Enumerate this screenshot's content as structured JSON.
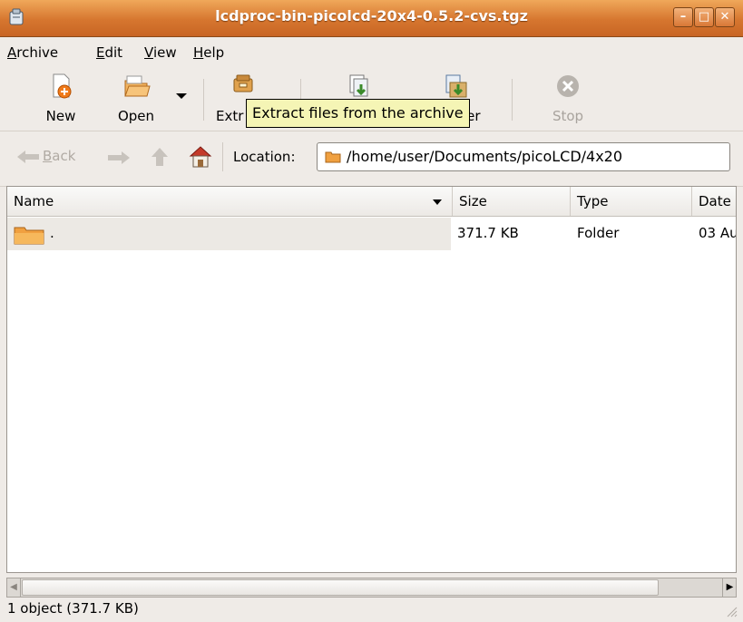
{
  "window": {
    "title": "lcdproc-bin-picolcd-20x4-0.5.2-cvs.tgz"
  },
  "menubar": {
    "items": [
      {
        "label_pre": "",
        "accel": "A",
        "label_post": "rchive"
      },
      {
        "label_pre": "",
        "accel": "E",
        "label_post": "dit"
      },
      {
        "label_pre": "",
        "accel": "V",
        "label_post": "iew"
      },
      {
        "label_pre": "",
        "accel": "H",
        "label_post": "elp"
      }
    ]
  },
  "toolbar": {
    "new_label": "New",
    "open_label": "Open",
    "extract_label": "Extr",
    "add_folder_label": "ler",
    "stop_label": "Stop"
  },
  "tooltip": {
    "text": "Extract files from the archive"
  },
  "location": {
    "back_label": "Back",
    "back_accel": "B",
    "back_rest": "ack",
    "location_label": "Location:",
    "path": "/home/user/Documents/picoLCD/4x20"
  },
  "list": {
    "columns": {
      "name": "Name",
      "size": "Size",
      "type": "Type",
      "date": "Date"
    },
    "rows": [
      {
        "name": ".",
        "size": "371.7 KB",
        "type": "Folder",
        "date": "03 Au"
      }
    ]
  },
  "statusbar": {
    "text": "1 object (371.7 KB)"
  },
  "colors": {
    "titlebar": "#d6762f",
    "tooltip_bg": "#f5f5b5",
    "folder": "#f0a040"
  }
}
